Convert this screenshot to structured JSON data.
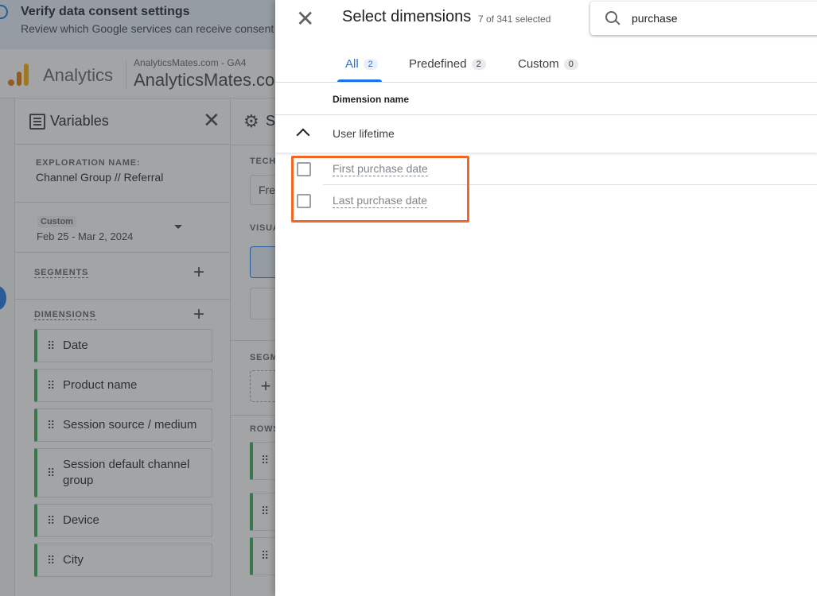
{
  "consent": {
    "title": "Verify data consent settings",
    "subtitle": "Review which Google services can receive consent"
  },
  "topbar": {
    "app_name": "Analytics",
    "account_small": "AnalyticsMates.com - GA4",
    "account_big": "AnalyticsMates.com"
  },
  "variables": {
    "title": "Variables",
    "exploration_label": "EXPLORATION NAME:",
    "exploration_name": "Channel Group // Referral",
    "date_chip": "Custom",
    "date_range": "Feb 25 - Mar 2, 2024",
    "segments_label": "SEGMENTS",
    "dimensions_label": "DIMENSIONS",
    "dimensions": [
      "Date",
      "Product name",
      "Session source / medium",
      "Session default channel group",
      "Device",
      "City"
    ]
  },
  "settings": {
    "title": "Settings",
    "technique_label": "TECHNIQUE",
    "technique_value": "Free form",
    "visualization_label": "VISUALIZATION",
    "segment_comparisons_label": "SEGMENT COMPARISONS",
    "rows_label": "ROWS"
  },
  "dialog": {
    "close_label": "✕",
    "title": "Select dimensions",
    "selected_count": "7 of 341 selected",
    "search": {
      "value": "purchase",
      "placeholder": "Search"
    },
    "tabs": [
      {
        "label": "All",
        "count": "2"
      },
      {
        "label": "Predefined",
        "count": "2"
      },
      {
        "label": "Custom",
        "count": "0"
      }
    ],
    "column_header": "Dimension name",
    "group": "User lifetime",
    "items": [
      {
        "label": "First purchase date",
        "checked": false
      },
      {
        "label": "Last purchase date",
        "checked": false
      }
    ]
  },
  "colors": {
    "accent": "#1a73e8",
    "highlight": "#f26522",
    "dimension_chip": "#34a853"
  }
}
